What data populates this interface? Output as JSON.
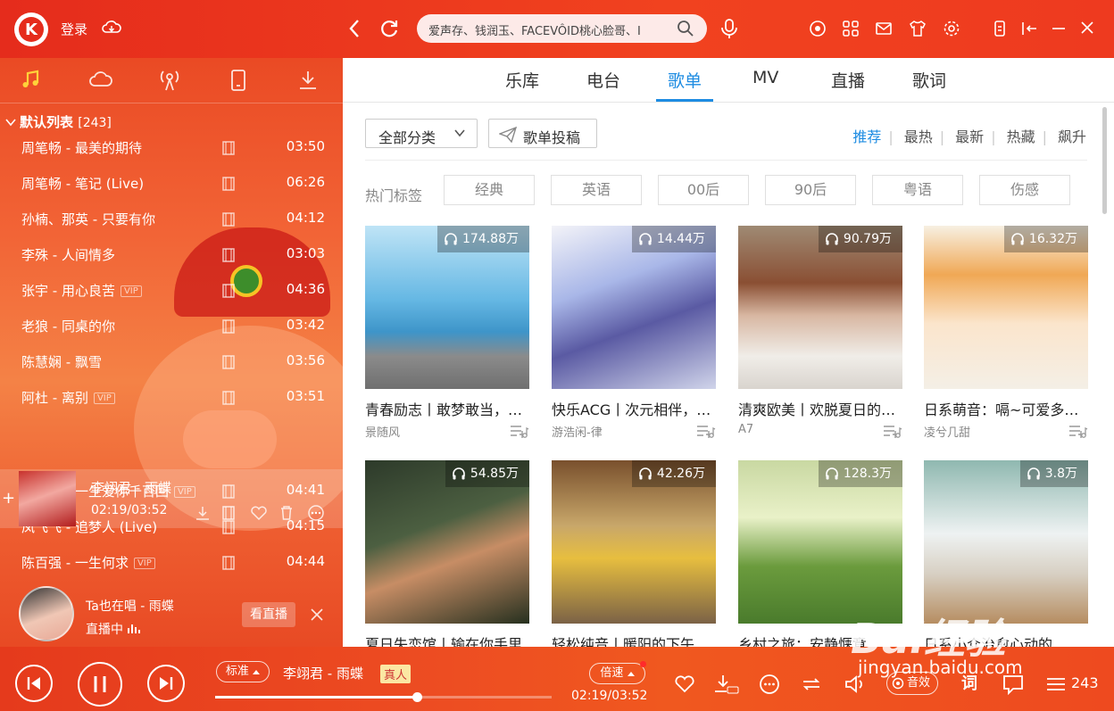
{
  "app": {
    "logo_letter": "K",
    "login": "登录"
  },
  "search": {
    "placeholder": "爱声存、钱润玉、FACEVÔID桃心脸哥、I"
  },
  "left_list": {
    "title": "默认列表",
    "count": "[243]",
    "songs": [
      {
        "title": "周笔畅 - 最美的期待",
        "duration": "03:50",
        "vip": false
      },
      {
        "title": "周笔畅 - 笔记 (Live)",
        "duration": "06:26",
        "vip": false
      },
      {
        "title": "孙楠、那英 - 只要有你",
        "duration": "04:12",
        "vip": false
      },
      {
        "title": "李殊 - 人间情多",
        "duration": "03:03",
        "vip": false
      },
      {
        "title": "张宇 - 用心良苦",
        "duration": "04:36",
        "vip": true
      },
      {
        "title": "老狼 - 同桌的你",
        "duration": "03:42",
        "vip": false
      },
      {
        "title": "陈慧娴 - 飘雪",
        "duration": "03:56",
        "vip": false
      },
      {
        "title": "阿杜 - 离别",
        "duration": "03:51",
        "vip": true
      },
      {
        "title": "梅艳芳 - 一生爱你千百回",
        "duration": "04:41",
        "vip": true
      },
      {
        "title": "凤飞飞 - 追梦人 (Live)",
        "duration": "04:15",
        "vip": false
      },
      {
        "title": "陈百强 - 一生何求",
        "duration": "04:44",
        "vip": true
      }
    ],
    "vip_label": "VIP",
    "now_playing": {
      "title": "李翊君 - 雨蝶",
      "time": "02:19/03:52"
    }
  },
  "live": {
    "title": "Ta也在唱 - 雨蝶",
    "status": "直播中",
    "button": "看直播"
  },
  "content": {
    "tabs": [
      "乐库",
      "电台",
      "歌单",
      "MV",
      "直播",
      "歌词"
    ],
    "active_tab": "歌单",
    "category_button": "全部分类",
    "submit_button": "歌单投稿",
    "sorts": [
      "推荐",
      "最热",
      "最新",
      "热藏",
      "飙升"
    ],
    "hot_tags_label": "热门标签",
    "tags": [
      "经典",
      "英语",
      "00后",
      "90后",
      "粤语",
      "伤感"
    ],
    "playlists": [
      {
        "title": "青春励志丨敢梦敢当，一起加油",
        "author": "景随风",
        "plays": "174.88万"
      },
      {
        "title": "快乐ACG丨次元相伴，欢乐无限",
        "author": "游浩闲-律",
        "plays": "14.44万"
      },
      {
        "title": "清爽欧美丨欢脱夏日的清凉之歌",
        "author": "A7",
        "plays": "90.79万"
      },
      {
        "title": "日系萌音：嗝~可爱多多的萌音",
        "author": "凌兮几甜",
        "plays": "16.32万"
      },
      {
        "title": "夏日失恋馆丨输在你手里",
        "author": "",
        "plays": "54.85万"
      },
      {
        "title": "轻松纯音丨暖阳的下午",
        "author": "",
        "plays": "42.26万"
      },
      {
        "title": "乡村之旅：安静惬意",
        "author": "",
        "plays": "128.3万"
      },
      {
        "title": "日系小众治愈心动的",
        "author": "",
        "plays": "3.8万"
      }
    ]
  },
  "player": {
    "quality": "标准",
    "title": "李翊君 - 雨蝶",
    "real_badge": "真人",
    "speed": "倍速",
    "time": "02:19/03:52",
    "progress": 0.6,
    "sound_effect": "音效",
    "lyrics": "词",
    "queue_count": "243"
  },
  "watermark": {
    "brand": "Bai经验",
    "url": "jingyan.baidu.com"
  },
  "colors": {
    "brand_red": "#e52c1c",
    "accent_blue": "#1e8ce2"
  }
}
